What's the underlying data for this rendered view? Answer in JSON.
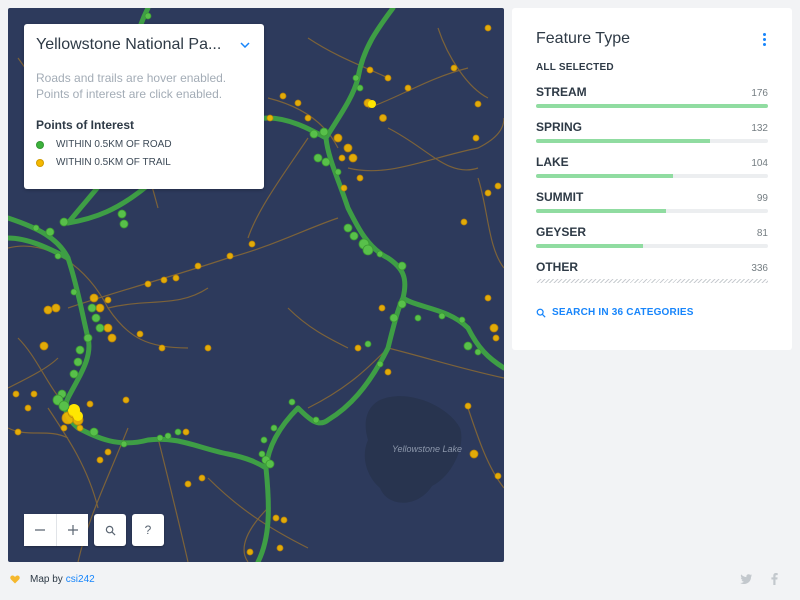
{
  "map": {
    "title": "Yellowstone National Pa...",
    "description_line1": "Roads and trails are hover enabled.",
    "description_line2": "Points of interest are click enabled.",
    "legend_heading": "Points of Interest",
    "legend_items": [
      {
        "label": "WITHIN 0.5KM OF ROAD",
        "color": "#3cb23c"
      },
      {
        "label": "WITHIN 0.5KM OF TRAIL",
        "color": "#f5b800"
      }
    ],
    "lake_label": "Yellowstone Lake",
    "background_color": "#2d3a5c",
    "road_color": "#3a9a3f",
    "trail_color": "#a07a3a",
    "controls": {
      "zoom_out_icon": "minus-icon",
      "zoom_in_icon": "plus-icon",
      "search_icon": "search-icon",
      "help_label": "?"
    }
  },
  "widget": {
    "title": "Feature Type",
    "status": "ALL SELECTED",
    "menu_icon": "vertical-dots-icon",
    "categories": [
      {
        "name": "STREAM",
        "count": "176",
        "fraction": 1.0
      },
      {
        "name": "SPRING",
        "count": "132",
        "fraction": 0.75
      },
      {
        "name": "LAKE",
        "count": "104",
        "fraction": 0.59
      },
      {
        "name": "SUMMIT",
        "count": "99",
        "fraction": 0.56
      },
      {
        "name": "GEYSER",
        "count": "81",
        "fraction": 0.46
      },
      {
        "name": "OTHER",
        "count": "336",
        "fraction": 1.0,
        "pattern": "hatched"
      }
    ],
    "search_label": "SEARCH IN 36 CATEGORIES",
    "accent_color": "#1785fb",
    "bar_color": "#90dca1"
  },
  "footer": {
    "map_by": "Map by",
    "author": "csi242",
    "icons": [
      "heart-icon",
      "twitter-icon",
      "facebook-icon"
    ]
  }
}
